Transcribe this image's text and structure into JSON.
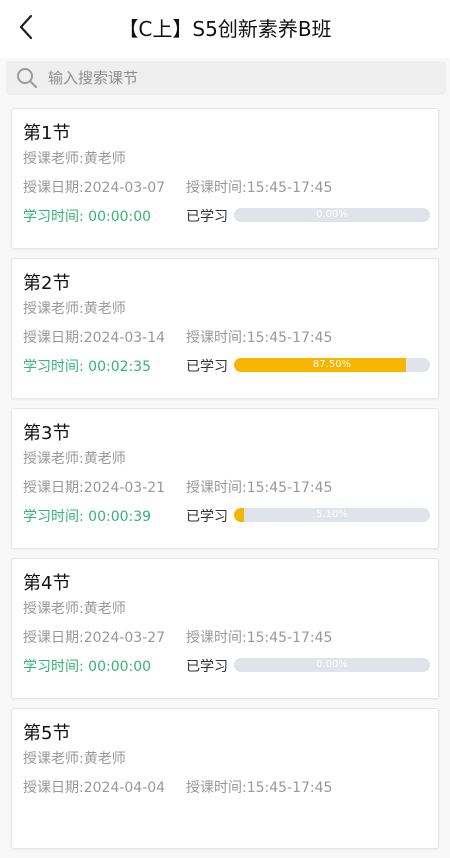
{
  "header": {
    "title": "【C上】S5创新素养B班"
  },
  "search": {
    "placeholder": "输入搜索课节"
  },
  "labels": {
    "learned": "已学习"
  },
  "colors": {
    "progress_fill": "#f7b500",
    "progress_track": "#dfe3ea",
    "study_time": "#34b37a"
  },
  "lessons": [
    {
      "title": "第1节",
      "teacher": "授课老师:黄老师",
      "date": "授课日期:2024-03-07",
      "time": "授课时间:15:45-17:45",
      "study_time": "学习时间: 00:00:00",
      "progress_text": "0.00%",
      "progress": 0.0
    },
    {
      "title": "第2节",
      "teacher": "授课老师:黄老师",
      "date": "授课日期:2024-03-14",
      "time": "授课时间:15:45-17:45",
      "study_time": "学习时间: 00:02:35",
      "progress_text": "87.50%",
      "progress": 87.5
    },
    {
      "title": "第3节",
      "teacher": "授课老师:黄老师",
      "date": "授课日期:2024-03-21",
      "time": "授课时间:15:45-17:45",
      "study_time": "学习时间: 00:00:39",
      "progress_text": "5.10%",
      "progress": 5.1
    },
    {
      "title": "第4节",
      "teacher": "授课老师:黄老师",
      "date": "授课日期:2024-03-27",
      "time": "授课时间:15:45-17:45",
      "study_time": "学习时间: 00:00:00",
      "progress_text": "0.00%",
      "progress": 0.0
    },
    {
      "title": "第5节",
      "teacher": "授课老师:黄老师",
      "date": "授课日期:2024-04-04",
      "time": "授课时间:15:45-17:45",
      "study_time": "",
      "progress_text": "",
      "progress": null
    }
  ]
}
